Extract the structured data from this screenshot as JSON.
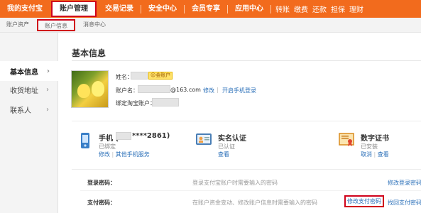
{
  "topnav": {
    "items": [
      "我的支付宝",
      "账户管理",
      "交易记录",
      "安全中心",
      "会员专享",
      "应用中心"
    ],
    "active_index": 1,
    "quick_links": [
      "转账",
      "缴费",
      "还款",
      "担保",
      "理财"
    ]
  },
  "subnav": {
    "items": [
      "账户资产",
      "账户信息",
      "消息中心"
    ],
    "active_index": 1
  },
  "sidebar": {
    "items": [
      {
        "label": "基本信息"
      },
      {
        "label": "收货地址"
      },
      {
        "label": "联系人"
      }
    ],
    "active_index": 0
  },
  "main": {
    "title": "基本信息",
    "profile": {
      "name_label": "姓名：",
      "badge_icon": "☺",
      "badge_text": "金账户",
      "account_label": "账户名：",
      "account_suffix": "@163.com",
      "modify_link": "修改",
      "phone_login_link": "开启手机登录",
      "taobao_label": "绑定淘宝账户："
    },
    "cards": [
      {
        "title_prefix": "手机 (",
        "title_suffix": "****2861)",
        "status": "已绑定",
        "links": [
          "修改",
          "其他手机服务"
        ],
        "icon": "mobile-phone-icon"
      },
      {
        "title": "实名认证",
        "status": "已认证",
        "links": [
          "查看"
        ],
        "icon": "id-card-icon"
      },
      {
        "title": "数字证书",
        "status": "已安装",
        "links": [
          "取消",
          "查看"
        ],
        "icon": "certificate-icon"
      }
    ],
    "passwords": [
      {
        "label": "登录密码：",
        "desc": "登录支付宝账户时需要输入的密码",
        "actions": [
          "修改登录密码"
        ]
      },
      {
        "label": "支付密码：",
        "desc": "在账户资金变动、修改账户信息时需要输入的密码",
        "actions": [
          "修改支付密码",
          "找回支付密码"
        ]
      }
    ]
  },
  "colors": {
    "brand_orange": "#f26b1d",
    "highlight_red": "#d0021b",
    "link_blue": "#2a6fb8"
  }
}
